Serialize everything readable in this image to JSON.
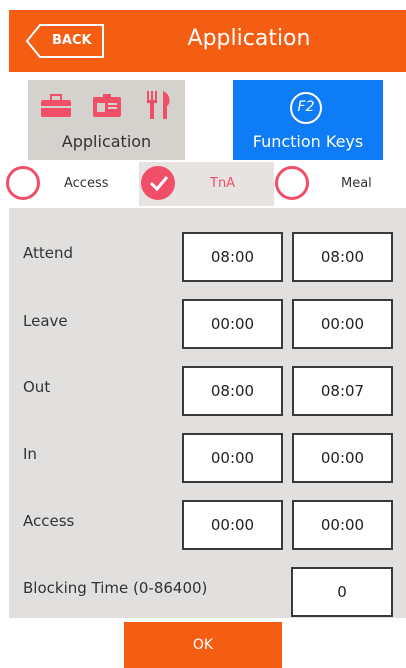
{
  "header": {
    "back_label": "BACK",
    "title": "Application"
  },
  "tabs": {
    "application": {
      "label": "Application",
      "icons": [
        "briefcase-icon",
        "id-card-icon",
        "fork-knife-icon"
      ]
    },
    "function_keys": {
      "label": "Function Keys",
      "badge": "F2"
    }
  },
  "modes": [
    {
      "label": "Access",
      "checked": false
    },
    {
      "label": "TnA",
      "checked": true
    },
    {
      "label": "Meal",
      "checked": false
    }
  ],
  "rows": [
    {
      "label": "Attend",
      "start": "08:00",
      "end": "08:00"
    },
    {
      "label": "Leave",
      "start": "00:00",
      "end": "00:00"
    },
    {
      "label": "Out",
      "start": "08:00",
      "end": "08:07"
    },
    {
      "label": "In",
      "start": "00:00",
      "end": "00:00"
    },
    {
      "label": "Access",
      "start": "00:00",
      "end": "00:00"
    }
  ],
  "blocking": {
    "label": "Blocking Time (0-86400)",
    "value": "0"
  },
  "footer": {
    "ok_label": "OK"
  },
  "colors": {
    "accent": "#f45d12",
    "blue": "#0f7cf7",
    "pink": "#f14f68",
    "panel": "#e1e0df"
  }
}
